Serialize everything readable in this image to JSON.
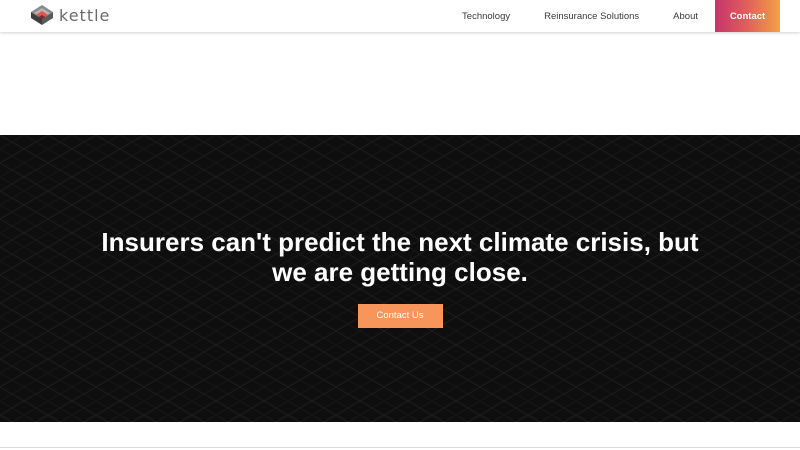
{
  "brand": {
    "name": "kettle",
    "logo_icon": "layered-cube-icon"
  },
  "nav": {
    "links": [
      "Technology",
      "Reinsurance Solutions",
      "About"
    ],
    "contact_label": "Contact"
  },
  "hero": {
    "title_line1": "Insurers can't predict the next climate crisis, but",
    "title_line2": "we are getting close.",
    "cta_label": "Contact Us"
  },
  "colors": {
    "hero_background": "#0f0e0f",
    "cta_orange": "#f7955a",
    "contact_gradient_start": "#c8336d",
    "contact_gradient_end": "#f1a246"
  }
}
